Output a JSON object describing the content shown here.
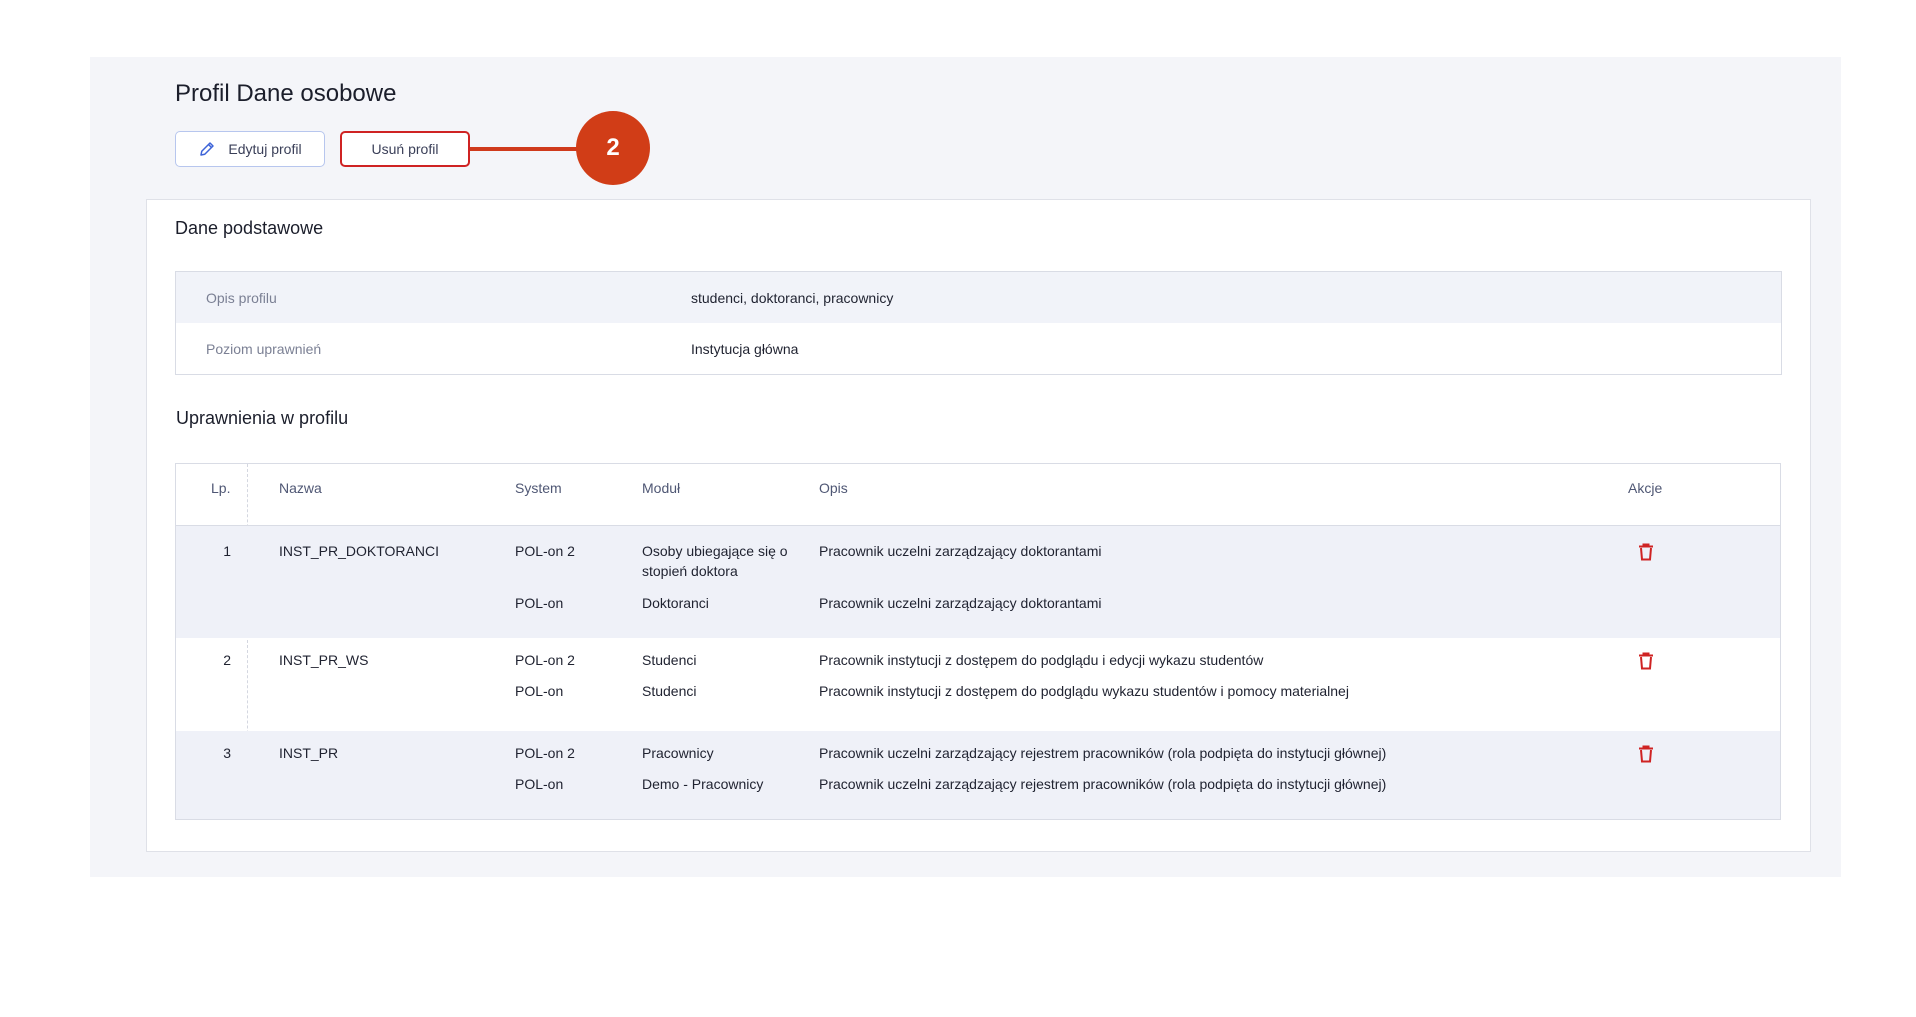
{
  "page": {
    "title": "Profil Dane osobowe"
  },
  "actions": {
    "edit_label": "Edytuj profil",
    "delete_label": "Usuń profil"
  },
  "callout": {
    "number": "2"
  },
  "basic": {
    "title": "Dane podstawowe",
    "rows": [
      {
        "label": "Opis profilu",
        "value": "studenci, doktoranci, pracownicy"
      },
      {
        "label": "Poziom uprawnień",
        "value": "Instytucja główna"
      }
    ]
  },
  "permissions": {
    "title": "Uprawnienia w profilu",
    "columns": {
      "lp": "Lp.",
      "name": "Nazwa",
      "system": "System",
      "module": "Moduł",
      "desc": "Opis",
      "actions": "Akcje"
    },
    "rows": [
      {
        "lp": "1",
        "name": "INST_PR_DOKTORANCI",
        "entries": [
          {
            "system": "POL-on 2",
            "module": "Osoby ubiegające się o stopień doktora",
            "desc": "Pracownik uczelni zarządzający doktorantami"
          },
          {
            "system": "POL-on",
            "module": "Doktoranci",
            "desc": "Pracownik uczelni zarządzający doktorantami"
          }
        ]
      },
      {
        "lp": "2",
        "name": "INST_PR_WS",
        "entries": [
          {
            "system": "POL-on 2",
            "module": "Studenci",
            "desc": "Pracownik instytucji z dostępem do podglądu i edycji wykazu studentów"
          },
          {
            "system": "POL-on",
            "module": "Studenci",
            "desc": "Pracownik instytucji z dostępem do podglądu wykazu studentów i pomocy materialnej"
          }
        ]
      },
      {
        "lp": "3",
        "name": "INST_PR",
        "entries": [
          {
            "system": "POL-on 2",
            "module": "Pracownicy",
            "desc": "Pracownik uczelni zarządzający rejestrem pracowników (rola podpięta do instytucji głównej)"
          },
          {
            "system": "POL-on",
            "module": "Demo - Pracownicy",
            "desc": "Pracownik uczelni zarządzający rejestrem pracowników (rola podpięta do instytucji głównej)"
          }
        ]
      }
    ]
  },
  "colors": {
    "accent_red": "#cf2323",
    "callout": "#d13d17",
    "edit_border": "#b7c6ee",
    "row_shade": "#eff1f8"
  },
  "icons": {
    "edit": "pencil-icon",
    "delete": "trash-icon"
  }
}
